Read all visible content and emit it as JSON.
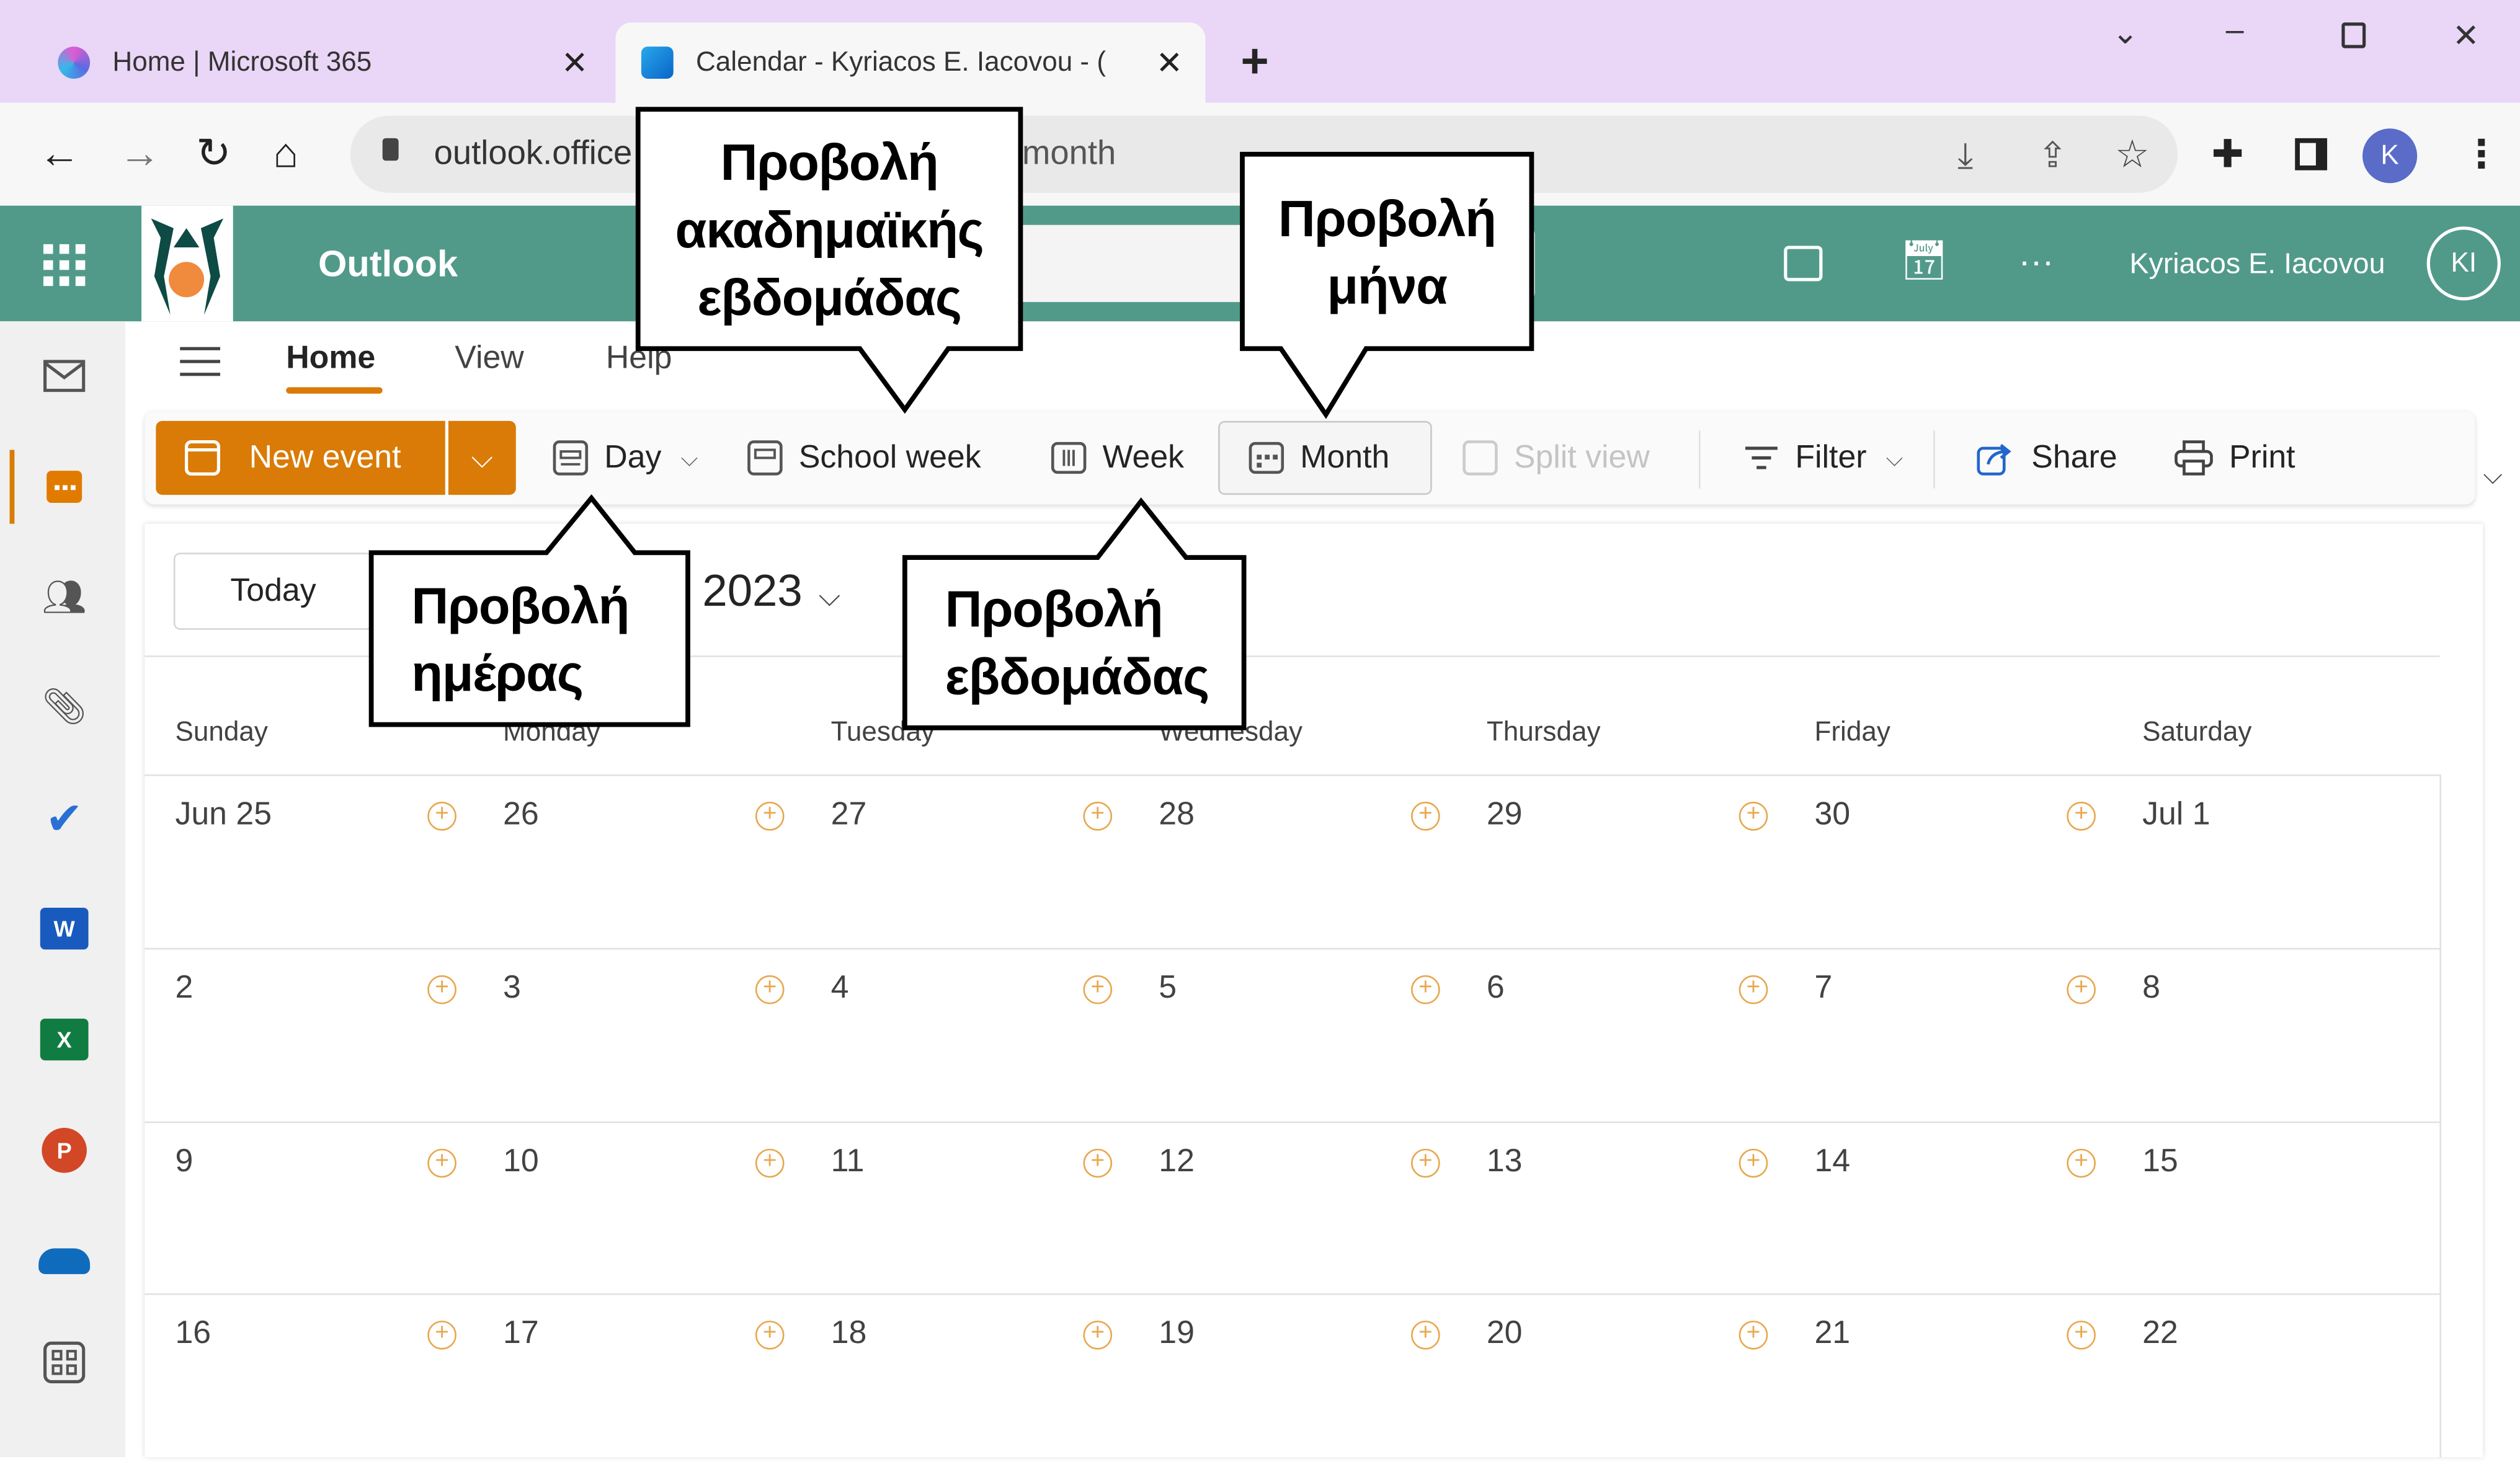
{
  "browser": {
    "tabs": [
      {
        "title": "Home | Microsoft 365",
        "active": false
      },
      {
        "title": "Calendar - Kyriacos E. Iacovou - (",
        "active": true
      }
    ],
    "new_tab": "+",
    "address_visible_start": "outlook.office",
    "address_visible_end": "month",
    "profile_initial": "K"
  },
  "outlook": {
    "app_name": "Outlook",
    "user_name": "Kyriacos E. Iacovou",
    "user_initials": "KI",
    "more": "···",
    "ribbon_tabs": [
      {
        "label": "Home",
        "active": true
      },
      {
        "label": "View",
        "active": false
      },
      {
        "label": "Help",
        "active": false
      }
    ],
    "commands": {
      "new_event": "New event",
      "day": "Day",
      "school_week": "School week",
      "week": "Week",
      "month": "Month",
      "split_view": "Split view",
      "filter": "Filter",
      "share": "Share",
      "print": "Print"
    },
    "today": "Today",
    "year": "2023",
    "weekdays": [
      "Sunday",
      "Monday",
      "Tuesday",
      "Wednesday",
      "Thursday",
      "Friday",
      "Saturday"
    ],
    "weeks": [
      [
        "Jun 25",
        "26",
        "27",
        "28",
        "29",
        "30",
        "Jul 1"
      ],
      [
        "2",
        "3",
        "4",
        "5",
        "6",
        "7",
        "8"
      ],
      [
        "9",
        "10",
        "11",
        "12",
        "13",
        "14",
        "15"
      ],
      [
        "16",
        "17",
        "18",
        "19",
        "20",
        "21",
        "22"
      ]
    ],
    "accent": "#d97b06",
    "header_color": "#519a8a"
  },
  "callouts": {
    "school_week": "Προβολή ακαδημαϊκής εβδομάδας",
    "month": "Προβολή μήνα",
    "day": "Προβολή ημέρας",
    "week": "Προβολή εβδομάδας"
  }
}
